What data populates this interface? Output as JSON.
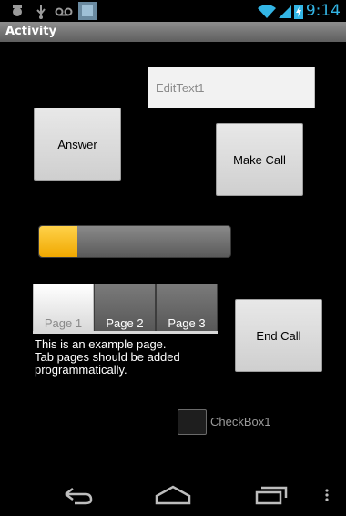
{
  "status_bar": {
    "time": "9:14",
    "icons": [
      "usb-debug-icon",
      "usb-icon",
      "voicemail-icon",
      "app-notification-icon",
      "wifi-icon",
      "signal-icon",
      "battery-charging-icon"
    ],
    "accent": "#33b5e5"
  },
  "title_bar": {
    "title": "Activity"
  },
  "edit_text": {
    "placeholder": "EditText1"
  },
  "buttons": {
    "answer": "Answer",
    "make_call": "Make Call",
    "end_call": "End Call"
  },
  "progress": {
    "value": 0.2,
    "fill_color": "#ffc21a"
  },
  "tabs": [
    {
      "label": "Page 1",
      "active": true
    },
    {
      "label": "Page 2",
      "active": false
    },
    {
      "label": "Page 3",
      "active": false
    }
  ],
  "tab_content": {
    "text": "This is an example page.\nTab pages should be added\nprogrammatically."
  },
  "checkbox": {
    "label": "CheckBox1",
    "checked": false
  },
  "nav_bar": {
    "icons": [
      "back-icon",
      "home-icon",
      "recents-icon",
      "menu-icon"
    ]
  }
}
